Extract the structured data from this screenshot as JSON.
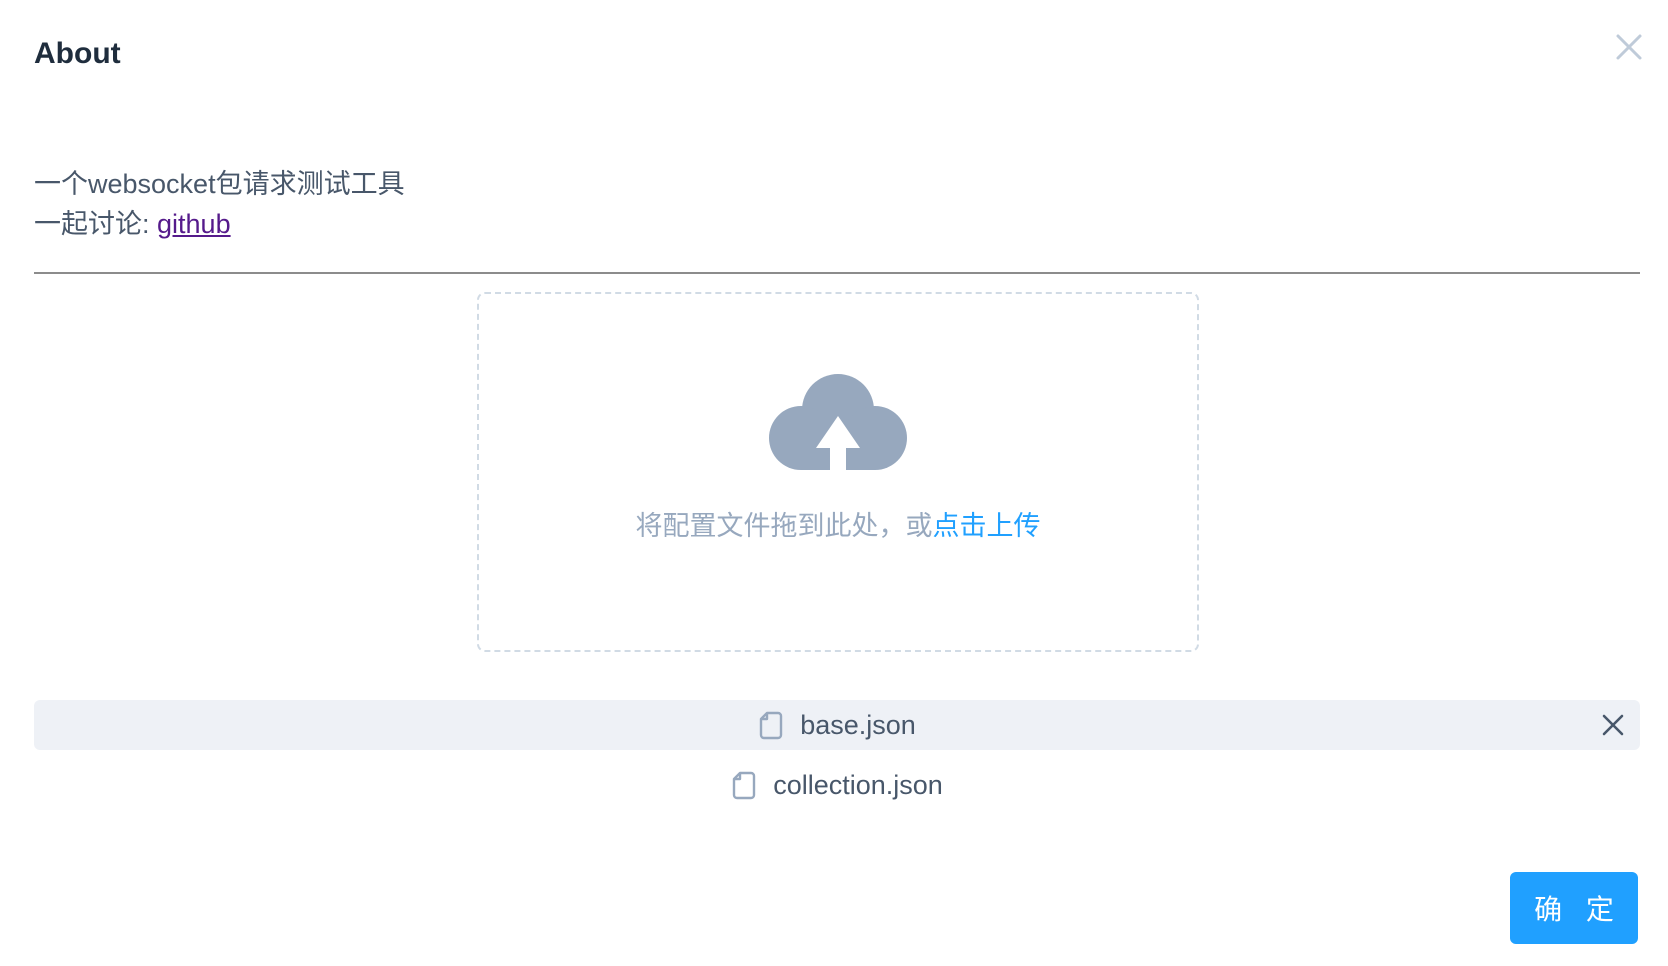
{
  "dialog": {
    "title": "About",
    "close_icon": "close-icon"
  },
  "about": {
    "line1": "一个websocket包请求测试工具",
    "line2_prefix": "一起讨论: ",
    "link_label": "github"
  },
  "upload": {
    "icon": "cloud-upload-icon",
    "hint": "将配置文件拖到此处，或",
    "click_label": "点击上传",
    "files": [
      {
        "name": "base.json",
        "icon": "document-icon",
        "selected": true
      },
      {
        "name": "collection.json",
        "icon": "document-icon",
        "selected": false
      }
    ]
  },
  "footer": {
    "confirm_label": "确 定"
  },
  "colors": {
    "primary": "#20a0ff",
    "text": "#48576a",
    "muted": "#97a8be",
    "selected_row": "#eef1f6",
    "link_visited": "#551a8b"
  }
}
